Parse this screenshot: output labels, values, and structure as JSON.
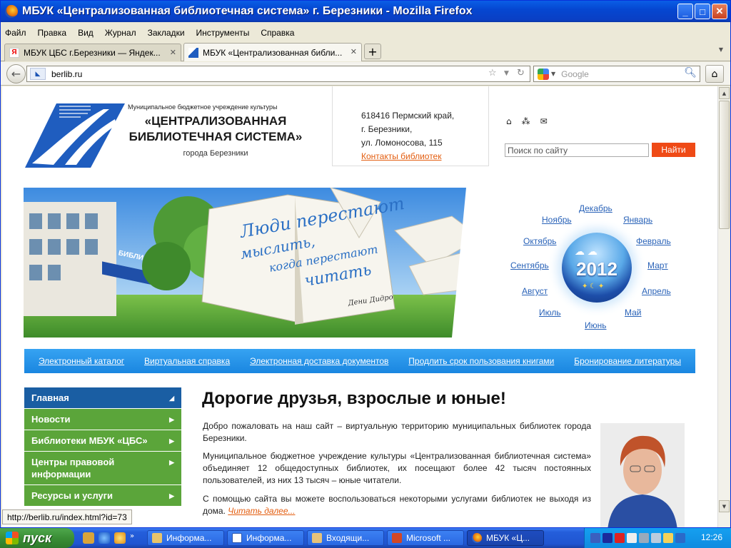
{
  "window": {
    "title": "МБУК «Централизованная библиотечная система» г. Березники - Mozilla Firefox",
    "min": "_",
    "max": "□",
    "close": "✕"
  },
  "menu": [
    "Файл",
    "Правка",
    "Вид",
    "Журнал",
    "Закладки",
    "Инструменты",
    "Справка"
  ],
  "tabs": [
    {
      "label": "МБУК ЦБС г.Березники — Яндек...",
      "close": "✕"
    },
    {
      "label": "МБУК «Централизованная библи...",
      "close": "✕"
    }
  ],
  "newtab": "+",
  "nav": {
    "url": "berlib.ru",
    "search_placeholder": "Google"
  },
  "page": {
    "org_small": "Муниципальное бюджетное учреждение культуры",
    "org_title_1": "«ЦЕНТРАЛИЗОВАННАЯ",
    "org_title_2": "БИБЛИОТЕЧНАЯ СИСТЕМА»",
    "org_city": "города Березники",
    "address": [
      "618416 Пермский край,",
      "г. Березники,",
      "ул. Ломоносова, 115"
    ],
    "contacts_link": "Контакты библиотек",
    "search_placeholder": "Поиск по сайту",
    "search_button": "Найти",
    "banner": {
      "line1": "Люди перестают",
      "line2": "мыслить,",
      "line3": "когда перестают",
      "line4": "читать",
      "author": "Дени Дидро",
      "sign": "БИБЛИОТЕК"
    },
    "calendar": {
      "year": "2012",
      "months": [
        "Декабрь",
        "Ноябрь",
        "Январь",
        "Октябрь",
        "Февраль",
        "Сентябрь",
        "Март",
        "Август",
        "Апрель",
        "Июль",
        "Май",
        "Июнь"
      ]
    },
    "navstrip": [
      "Электронный каталог",
      "Виртуальная справка",
      "Электронная доставка документов",
      "Продлить срок пользования книгами",
      "Бронирование литературы"
    ],
    "sidenav": [
      {
        "label": "Главная",
        "arrow": "◢",
        "color": "#1a5ea3"
      },
      {
        "label": "Новости",
        "arrow": "▶",
        "color": "#5ba53a"
      },
      {
        "label": "Библиотеки МБУК «ЦБС»",
        "arrow": "▶",
        "color": "#5ba53a"
      },
      {
        "label": "Центры правовой информации",
        "arrow": "▶",
        "color": "#5ba53a"
      },
      {
        "label": "Ресурсы и услуги",
        "arrow": "▶",
        "color": "#5ba53a"
      }
    ],
    "heading": "Дорогие друзья, взрослые и юные!",
    "p1": "Добро пожаловать на наш сайт – виртуальную территорию муниципальных библиотек города Березники.",
    "p2": "Муниципальное бюджетное учреждение культуры «Централизованная библиотечная система» объединяет 12 общедоступных библиотек, их посещают более 42 тысяч постоянных пользователей, из них 13 тысяч – юные читатели.",
    "p3": "С помощью сайта вы можете воспользоваться некоторыми услугами библиотек не выходя из дома.",
    "read_more": "Читать далее..."
  },
  "status": "http://berlib.ru/index.html?id=73",
  "taskbar": {
    "start": "пуск",
    "tasks": [
      "Информа...",
      "Информа...",
      "Входящи...",
      "Microsoft ...",
      "МБУК «Ц..."
    ],
    "clock": "12:26"
  }
}
